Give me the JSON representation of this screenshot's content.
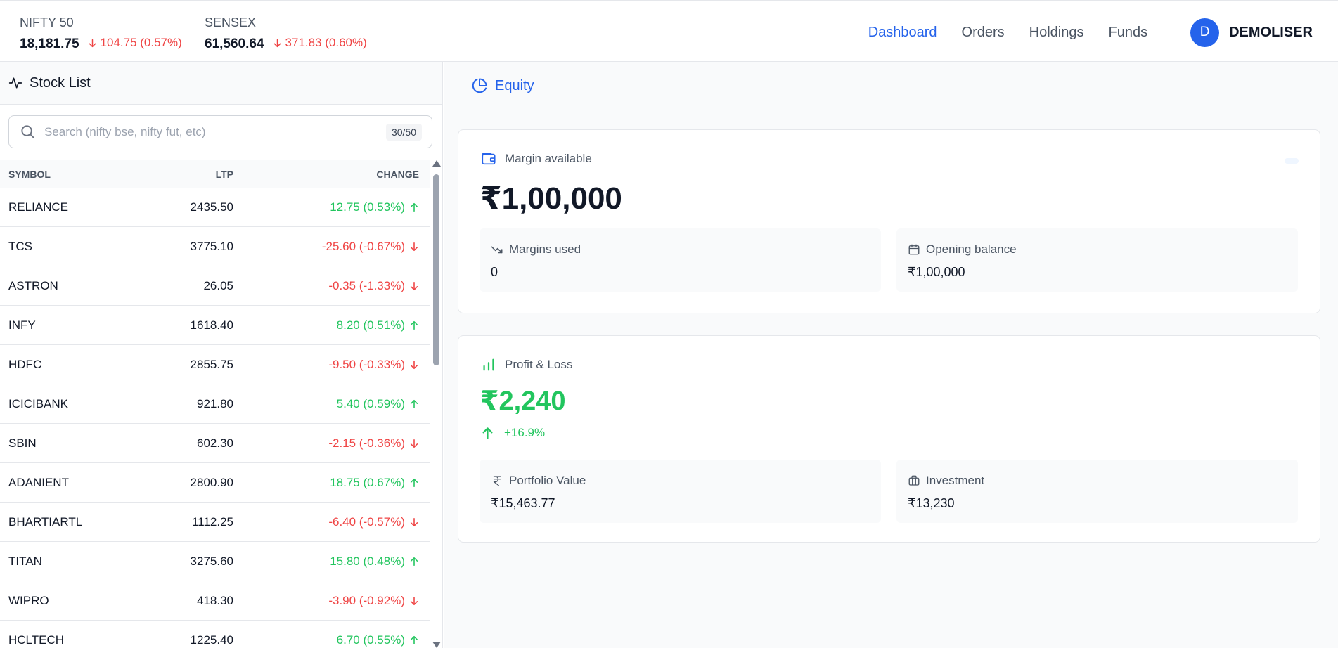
{
  "indices": [
    {
      "name": "NIFTY 50",
      "value": "18,181.75",
      "change": "104.75 (0.57%)"
    },
    {
      "name": "SENSEX",
      "value": "61,560.64",
      "change": "371.83 (0.60%)"
    }
  ],
  "nav": {
    "items": [
      "Dashboard",
      "Orders",
      "Holdings",
      "Funds"
    ],
    "active": "Dashboard",
    "avatar_letter": "D",
    "username": "DEMOLISER"
  },
  "stock_list": {
    "title": "Stock List",
    "search_placeholder": "Search (nifty bse, nifty fut, etc)",
    "count": "30/50",
    "columns": {
      "symbol": "SYMBOL",
      "ltp": "LTP",
      "change": "CHANGE"
    },
    "rows": [
      {
        "symbol": "RELIANCE",
        "ltp": "2435.50",
        "change": "12.75 (0.53%)",
        "dir": "up"
      },
      {
        "symbol": "TCS",
        "ltp": "3775.10",
        "change": "-25.60 (-0.67%)",
        "dir": "down"
      },
      {
        "symbol": "ASTRON",
        "ltp": "26.05",
        "change": "-0.35 (-1.33%)",
        "dir": "down"
      },
      {
        "symbol": "INFY",
        "ltp": "1618.40",
        "change": "8.20 (0.51%)",
        "dir": "up"
      },
      {
        "symbol": "HDFC",
        "ltp": "2855.75",
        "change": "-9.50 (-0.33%)",
        "dir": "down"
      },
      {
        "symbol": "ICICIBANK",
        "ltp": "921.80",
        "change": "5.40 (0.59%)",
        "dir": "up"
      },
      {
        "symbol": "SBIN",
        "ltp": "602.30",
        "change": "-2.15 (-0.36%)",
        "dir": "down"
      },
      {
        "symbol": "ADANIENT",
        "ltp": "2800.90",
        "change": "18.75 (0.67%)",
        "dir": "up"
      },
      {
        "symbol": "BHARTIARTL",
        "ltp": "1112.25",
        "change": "-6.40 (-0.57%)",
        "dir": "down"
      },
      {
        "symbol": "TITAN",
        "ltp": "3275.60",
        "change": "15.80 (0.48%)",
        "dir": "up"
      },
      {
        "symbol": "WIPRO",
        "ltp": "418.30",
        "change": "-3.90 (-0.92%)",
        "dir": "down"
      },
      {
        "symbol": "HCLTECH",
        "ltp": "1225.40",
        "change": "6.70 (0.55%)",
        "dir": "up"
      }
    ]
  },
  "equity": {
    "tab_label": "Equity",
    "margin": {
      "title": "Margin available",
      "amount": "₹1,00,000",
      "used_label": "Margins used",
      "used_value": "0",
      "opening_label": "Opening balance",
      "opening_value": "₹1,00,000"
    },
    "pnl": {
      "title": "Profit & Loss",
      "amount": "₹2,240",
      "percent": "+16.9%",
      "portfolio_label": "Portfolio Value",
      "portfolio_value": "₹15,463.77",
      "investment_label": "Investment",
      "investment_value": "₹13,230"
    }
  },
  "colors": {
    "accent": "#2563eb",
    "up": "#22c55e",
    "down": "#ef4444"
  }
}
